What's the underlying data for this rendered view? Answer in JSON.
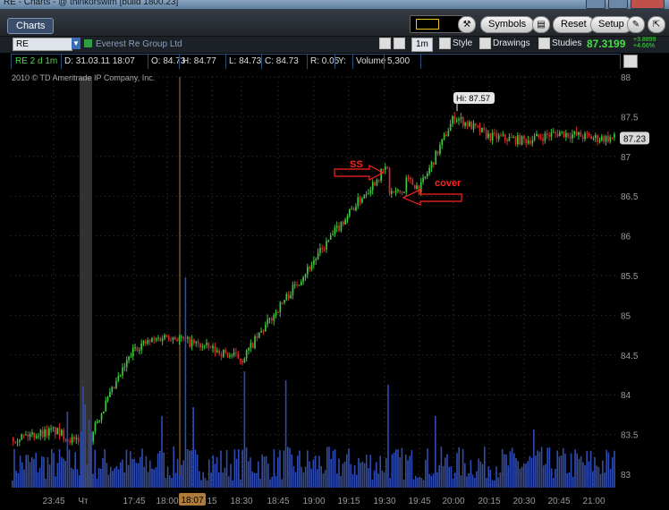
{
  "window": {
    "title": "RE - Charts - @ thinkorswim [build 1800.23]"
  },
  "toolbar": {
    "tab_charts": "Charts",
    "symbols_label": "Symbols",
    "reset_label": "Reset",
    "setup_label": "Setup"
  },
  "symbol_bar": {
    "symbol": "RE",
    "company": "Everest Re Group Ltd",
    "interval": "1m",
    "style_label": "Style",
    "drawings_label": "Drawings",
    "studies_label": "Studies",
    "last_price": "87.3199",
    "change_abs": "+3.8899",
    "change_pct": "+4.66%"
  },
  "info": {
    "period": "RE 2 d 1m",
    "date": "D: 31.03.11 18:07",
    "open": "O: 84.73",
    "high": "H: 84.77",
    "low": "L: 84.73",
    "close": "C: 84.73",
    "range": "R: 0.05",
    "y": "Y:",
    "volume_label": "Volume",
    "volume_value": "5,300"
  },
  "copyright": "2010 © TD Ameritrade IP Company, Inc.",
  "annotations": {
    "ss": "SS",
    "cover": "cover",
    "hi": "Hi: 87.57",
    "last_tag": "87.23",
    "cursor_time": "18:07"
  },
  "colors": {
    "up": "#3ec43e",
    "down": "#d42a2a",
    "volume": "#2f4bb0",
    "grid": "#3a3a3a",
    "annotation": "#ff2020"
  },
  "chart_data": {
    "type": "candlestick",
    "price_axis": {
      "min": 83,
      "max": 88,
      "ticks": [
        "88",
        "87.5",
        "87",
        "86.5",
        "86",
        "85.5",
        "85",
        "84.5",
        "84",
        "83.5",
        "83"
      ]
    },
    "time_ticks": [
      "23:45",
      "Чт",
      "17:45",
      "18:00",
      "18:07",
      "15",
      "18:30",
      "18:45",
      "19:00",
      "19:15",
      "19:30",
      "19:45",
      "20:00",
      "20:15",
      "20:30",
      "20:45",
      "21:00"
    ],
    "high_marker": 87.57,
    "last_price": 87.23,
    "price_path": [
      {
        "time": "23:45",
        "price": 83.55
      },
      {
        "time": "Чт",
        "price": 83.35
      },
      {
        "time": "17:45",
        "price": 84.6
      },
      {
        "time": "18:00",
        "price": 84.75
      },
      {
        "time": "18:30",
        "price": 84.45
      },
      {
        "time": "18:45",
        "price": 85.1
      },
      {
        "time": "19:00",
        "price": 85.7
      },
      {
        "time": "19:15",
        "price": 86.3
      },
      {
        "time": "19:30",
        "price": 86.85
      },
      {
        "time": "19:45",
        "price": 86.6
      },
      {
        "time": "20:00",
        "price": 87.5
      },
      {
        "time": "20:15",
        "price": 87.25
      },
      {
        "time": "20:30",
        "price": 87.2
      },
      {
        "time": "20:45",
        "price": 87.3
      },
      {
        "time": "21:00",
        "price": 87.23
      }
    ]
  }
}
